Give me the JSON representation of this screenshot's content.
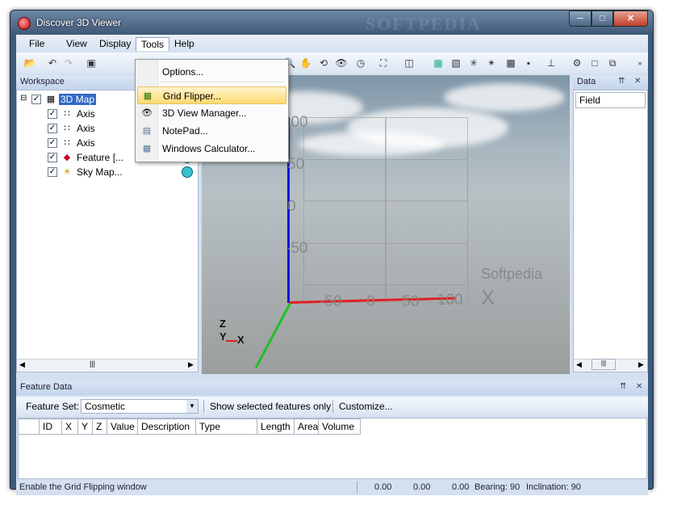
{
  "window": {
    "title": "Discover 3D Viewer",
    "watermark": "SOFTPEDIA"
  },
  "menubar": {
    "items": [
      "File",
      "View",
      "Display",
      "Tools",
      "Help"
    ]
  },
  "tools_menu": {
    "items": [
      {
        "label": "Options...",
        "icon": "options-icon"
      },
      {
        "label": "Grid Flipper...",
        "icon": "grid-flipper-icon"
      },
      {
        "label": "3D View Manager...",
        "icon": "eye-3d-icon"
      },
      {
        "label": "NotePad...",
        "icon": "notepad-icon"
      },
      {
        "label": "Windows Calculator...",
        "icon": "calculator-icon"
      }
    ],
    "highlighted": "Grid Flipper..."
  },
  "workspace": {
    "title": "Workspace",
    "tree": [
      {
        "label": "3D Map",
        "checked": true,
        "selected": true
      },
      {
        "label": "Axis",
        "checked": true
      },
      {
        "label": "Axis",
        "checked": true
      },
      {
        "label": "Axis",
        "checked": true
      },
      {
        "label": "Feature [...",
        "checked": true
      },
      {
        "label": "Sky Map...",
        "checked": true
      }
    ]
  },
  "view3d": {
    "vertical_labels": [
      "100",
      "50",
      "0",
      "-50"
    ],
    "horizontal_labels": [
      "-50",
      "0",
      "50",
      "100"
    ],
    "axis_x_label": "X",
    "mini_axis": {
      "z": "Z",
      "y": "Y",
      "x": "X"
    },
    "watermark": "Softpedia",
    "colors": {
      "x_axis": "#e02020",
      "y_axis": "#20c020",
      "z_axis": "#1010e0"
    }
  },
  "data_panel": {
    "title": "Data",
    "column": "Field"
  },
  "feature_data": {
    "title": "Feature Data",
    "feature_set_label": "Feature Set:",
    "feature_set_value": "Cosmetic",
    "show_selected_label": "Show selected features only",
    "customize_label": "Customize...",
    "columns": [
      "ID",
      "X",
      "Y",
      "Z",
      "Value",
      "Description",
      "Type",
      "Length",
      "Area",
      "Volume"
    ]
  },
  "statusbar": {
    "message": "Enable the Grid Flipping window",
    "values": [
      "0.00",
      "0.00",
      "0.00"
    ],
    "bearing": "Bearing: 90",
    "inclination": "Inclination: 90"
  }
}
